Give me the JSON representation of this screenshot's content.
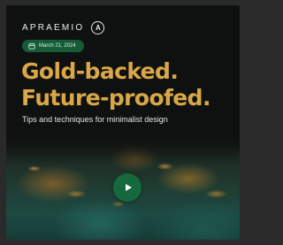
{
  "brand": {
    "name": "APRAEMIO",
    "logo_letter": "A"
  },
  "date_pill": {
    "icon": "calendar-icon",
    "text": "March 21, 2024"
  },
  "headline": {
    "line1": "Gold-backed.",
    "line2": "Future-proofed."
  },
  "tagline": "Tips and techniques for minimalist design",
  "hero": {
    "play_icon": "play-icon"
  },
  "colors": {
    "background": "#0f1110",
    "headline": "#d9a748",
    "pill": "#155c36",
    "play_button": "#146a3c"
  }
}
